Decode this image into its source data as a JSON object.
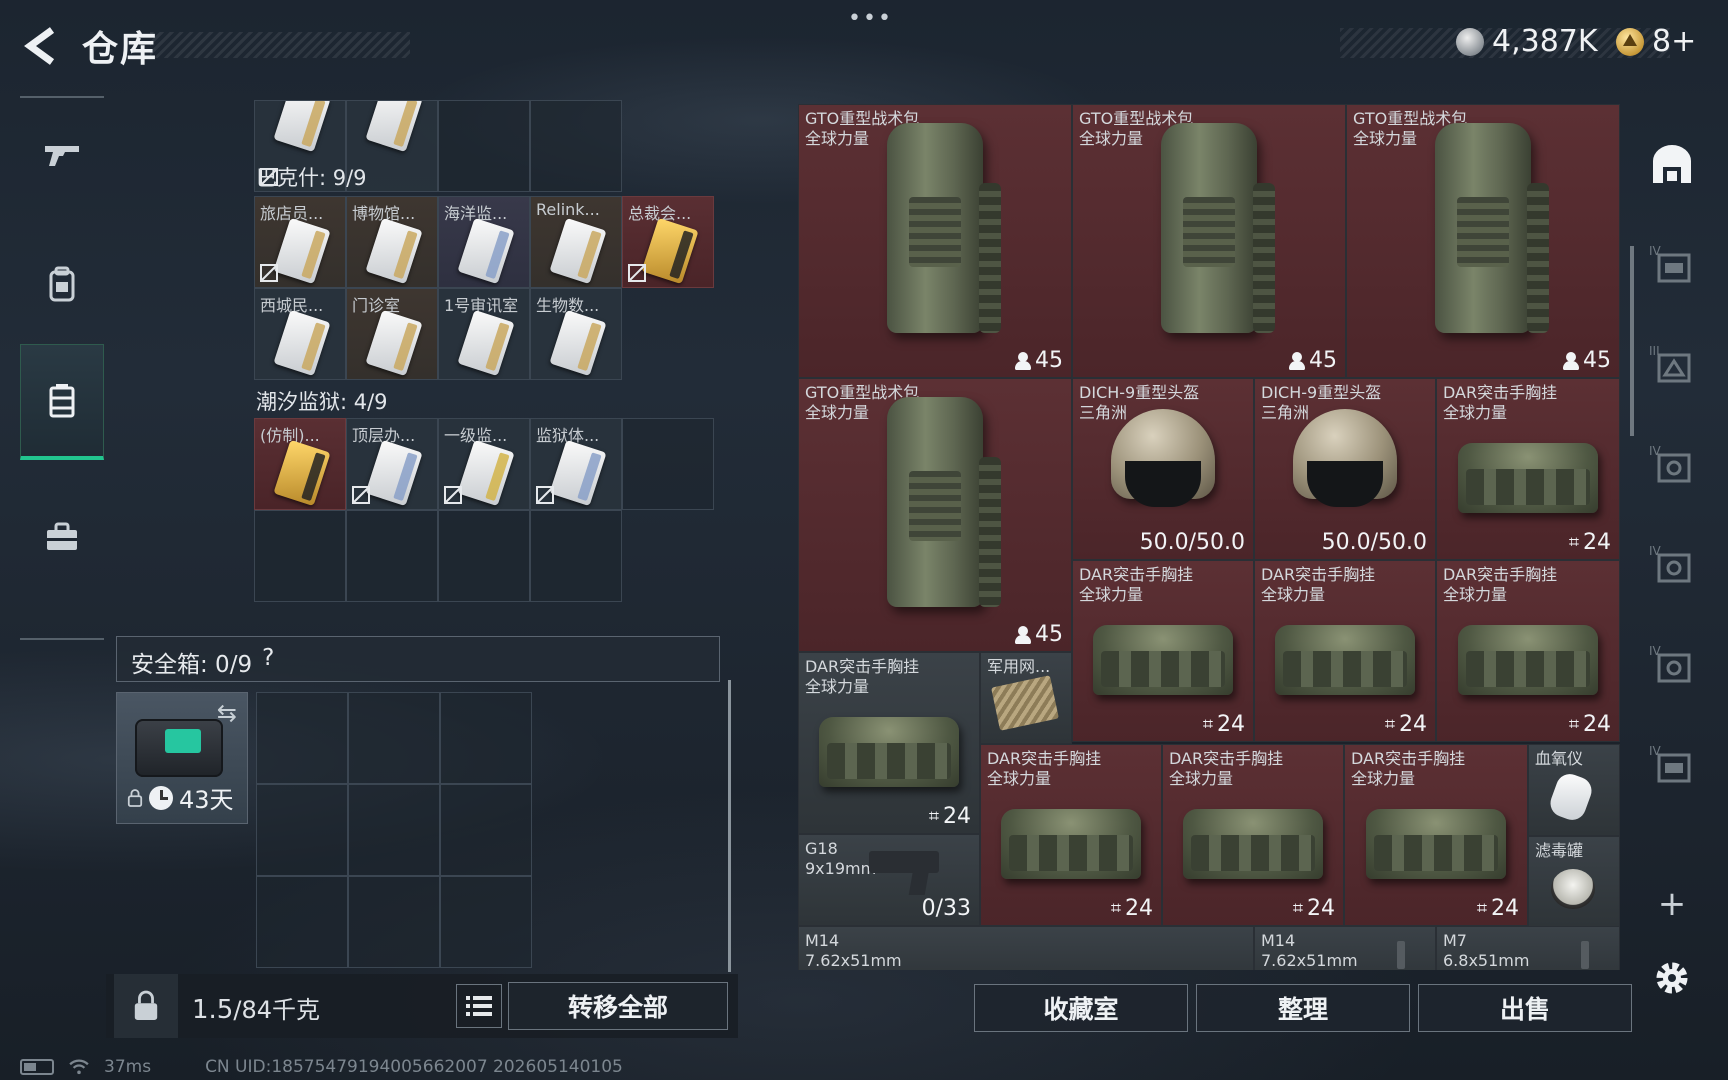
{
  "header": {
    "title": "仓库",
    "more": "•••",
    "currency_silver": "4,387K",
    "currency_gold": "8+"
  },
  "left_nav": {
    "items": [
      {
        "icon": "gun-icon",
        "active": false
      },
      {
        "icon": "backpack-icon",
        "active": false
      },
      {
        "icon": "vest-icon",
        "active": true
      },
      {
        "icon": "briefcase-icon",
        "active": false
      }
    ]
  },
  "containers": {
    "top_partial": [
      "",
      "",
      "",
      ""
    ],
    "bakesh": {
      "title": "巴克什: 9/9",
      "cards": [
        "旅店员...",
        "博物馆...",
        "海洋监...",
        "Relink...",
        "总裁会...",
        "西城民...",
        "门诊室",
        "1号审讯室",
        "生物数..."
      ]
    },
    "tide_prison": {
      "title": "潮汐监狱: 4/9",
      "cards": [
        "(仿制)...",
        "顶层办...",
        "一级监...",
        "监狱体..."
      ]
    }
  },
  "safebox": {
    "label": "安全箱: 0/9",
    "help": "?",
    "item_days": "43天",
    "swap": "⇆"
  },
  "bottom_left": {
    "weight_current": "1.5",
    "weight_rest": "/84千克",
    "transfer_all": "转移全部"
  },
  "inventory": {
    "backpack_name_1": "GTO重型战术包",
    "backpack_name_2": "全球力量",
    "backpack_capacity": "45",
    "helmet_name_1": "DICH-9重型头盔",
    "helmet_name_2": "三角洲",
    "helmet_durability": "50.0/50.0",
    "rig_name_1": "DAR突击手胸挂",
    "rig_name_2": "全球力量",
    "rig_capacity": "24",
    "ammo_box_name": "军用网...",
    "oximeter_name": "血氧仪",
    "canister_name": "滤毒罐",
    "g18_name_1": "G18",
    "g18_name_2": "9x19mm",
    "g18_ammo": "0/33",
    "m14_name_1": "M14",
    "m14_name_2": "7.62x51mm",
    "m7_name_1": "M7",
    "m7_name_2": "6.8x51mm"
  },
  "bottom_right": {
    "collection": "收藏室",
    "sort": "整理",
    "sell": "出售"
  },
  "right_rail": {
    "plus": "+"
  },
  "status": {
    "ping": "37ms",
    "uid": "CN UID:18575479194005662007 202605140105"
  }
}
